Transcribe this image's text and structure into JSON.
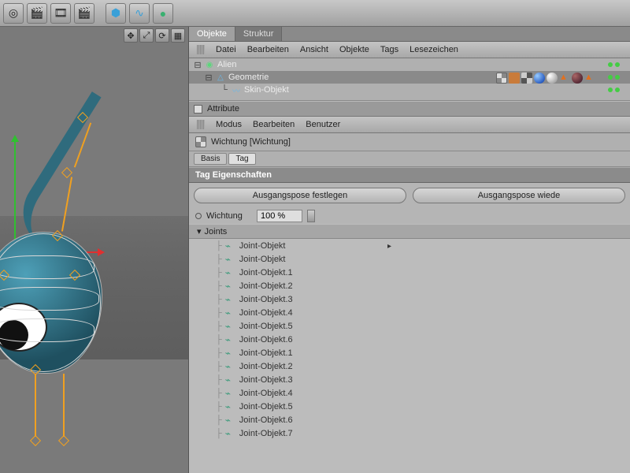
{
  "topbar": {
    "icons": [
      "cube-icon",
      "clapper-icon",
      "film-icon",
      "clapper2-icon",
      "cube2-icon",
      "link-icon",
      "sphere-icon"
    ]
  },
  "panels": {
    "objects_tab": "Objekte",
    "structure_tab": "Struktur",
    "menus": [
      "Datei",
      "Bearbeiten",
      "Ansicht",
      "Objekte",
      "Tags",
      "Lesezeichen"
    ]
  },
  "hierarchy": [
    {
      "name": "Alien",
      "indent": 0,
      "icon": "group",
      "selected": false
    },
    {
      "name": "Geometrie",
      "indent": 1,
      "icon": "poly",
      "selected": true
    },
    {
      "name": "Skin-Objekt",
      "indent": 2,
      "icon": "skin",
      "selected": false
    }
  ],
  "attribute": {
    "panel_label": "Attribute",
    "menus": [
      "Modus",
      "Bearbeiten",
      "Benutzer"
    ],
    "title": "Wichtung [Wichtung]",
    "subtabs": {
      "basis": "Basis",
      "tag": "Tag"
    },
    "section": "Tag Eigenschaften",
    "buttons": {
      "set_pose": "Ausgangspose festlegen",
      "reset_pose": "Ausgangspose wiede"
    },
    "weight_label": "Wichtung",
    "weight_value": "100 %",
    "joints_label": "Joints"
  },
  "joints": [
    "Joint-Objekt",
    "Joint-Objekt",
    "Joint-Objekt.1",
    "Joint-Objekt.2",
    "Joint-Objekt.3",
    "Joint-Objekt.4",
    "Joint-Objekt.5",
    "Joint-Objekt.6",
    "Joint-Objekt.1",
    "Joint-Objekt.2",
    "Joint-Objekt.3",
    "Joint-Objekt.4",
    "Joint-Objekt.5",
    "Joint-Objekt.6",
    "Joint-Objekt.7"
  ]
}
